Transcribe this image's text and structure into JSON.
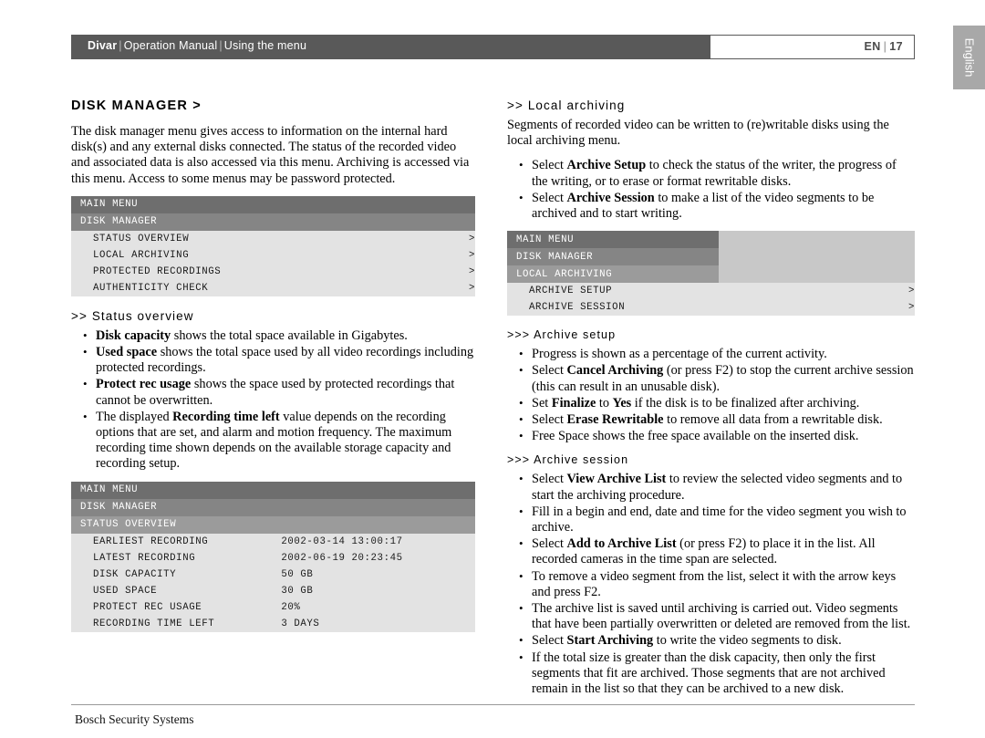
{
  "header": {
    "brand": "Divar",
    "manual": "Operation Manual",
    "chapter": "Using the menu",
    "lang": "EN",
    "page": "17",
    "side_tab": "English"
  },
  "left": {
    "title": "Disk manager >",
    "intro": "The disk manager menu gives access to information on the internal hard disk(s) and any external disks connected. The status of the recorded video and associated data is also accessed via this menu. Archiving is accessed via this menu. Access to some menus may be password protected.",
    "menu1": {
      "rows": [
        {
          "type": "main",
          "label": "MAIN MENU",
          "arrow": ""
        },
        {
          "type": "lvl2",
          "label": "DISK MANAGER",
          "arrow": ""
        },
        {
          "type": "item",
          "label": "STATUS OVERVIEW",
          "arrow": ">"
        },
        {
          "type": "item",
          "label": "LOCAL ARCHIVING",
          "arrow": ">"
        },
        {
          "type": "item",
          "label": "PROTECTED RECORDINGS",
          "arrow": ">"
        },
        {
          "type": "item",
          "label": "AUTHENTICITY CHECK",
          "arrow": ">"
        }
      ]
    },
    "status_overview": {
      "heading": ">> Status overview",
      "bullets": [
        {
          "bold": "Disk capacity",
          "rest": " shows the total space available in Gigabytes."
        },
        {
          "bold": "Used space",
          "rest": " shows the total space used by all video recordings including protected recordings."
        },
        {
          "bold": "Protect rec usage",
          "rest": " shows the space used by protected recordings that cannot be overwritten."
        },
        {
          "pre": "The displayed ",
          "bold": "Recording time left",
          "rest": " value depends on the recording options that are set, and alarm and motion frequency. The maximum recording time shown depends on the available storage capacity and recording setup."
        }
      ]
    },
    "menu2": {
      "rows": [
        {
          "type": "main",
          "label": "MAIN MENU",
          "value": ""
        },
        {
          "type": "lvl2",
          "label": "DISK MANAGER",
          "value": ""
        },
        {
          "type": "lvl3",
          "label": "STATUS OVERVIEW",
          "value": ""
        },
        {
          "type": "item",
          "label": "EARLIEST RECORDING",
          "value": "2002-03-14 13:00:17"
        },
        {
          "type": "item",
          "label": "LATEST RECORDING",
          "value": "2002-06-19 20:23:45"
        },
        {
          "type": "item",
          "label": "DISK CAPACITY",
          "value": "50 GB"
        },
        {
          "type": "item",
          "label": "USED SPACE",
          "value": "30 GB"
        },
        {
          "type": "item",
          "label": "PROTECT REC USAGE",
          "value": "20%"
        },
        {
          "type": "item",
          "label": "RECORDING TIME LEFT",
          "value": "3 DAYS"
        }
      ]
    }
  },
  "right": {
    "local_archiving": {
      "heading": ">> Local archiving",
      "intro": "Segments of recorded video can be written to (re)writable disks using the local archiving menu.",
      "bullets": [
        {
          "pre": "Select ",
          "bold": "Archive Setup",
          "rest": " to check the status of the writer, the progress of the writing, or to erase or format rewritable disks."
        },
        {
          "pre": "Select ",
          "bold": "Archive Session",
          "rest": " to make a list of the video segments to be archived and to start writing."
        }
      ]
    },
    "menu3": {
      "rows": [
        {
          "type": "main",
          "label": "MAIN MENU",
          "arrow": "",
          "split": true
        },
        {
          "type": "lvl2",
          "label": "DISK MANAGER",
          "arrow": "",
          "split": true
        },
        {
          "type": "lvl3",
          "label": "LOCAL ARCHIVING",
          "arrow": "",
          "split": true
        },
        {
          "type": "item",
          "label": "ARCHIVE SETUP",
          "arrow": ">",
          "split": false
        },
        {
          "type": "item",
          "label": "ARCHIVE SESSION",
          "arrow": ">",
          "split": false
        }
      ]
    },
    "archive_setup": {
      "heading": ">>> Archive setup",
      "bullets": [
        {
          "rest": "Progress is shown as a percentage of the current activity."
        },
        {
          "pre": "Select ",
          "bold": "Cancel Archiving",
          "rest": " (or press F2) to stop the current archive session (this can result in an unusable disk)."
        },
        {
          "pre": "Set ",
          "bold": "Finalize",
          "mid": " to ",
          "bold2": "Yes",
          "rest": " if the disk is to be finalized after archiving."
        },
        {
          "pre": "Select ",
          "bold": "Erase Rewritable",
          "rest": " to remove all data from a rewritable disk."
        },
        {
          "rest": "Free Space shows the free space available on the inserted disk."
        }
      ]
    },
    "archive_session": {
      "heading": ">>> Archive session",
      "bullets": [
        {
          "pre": "Select ",
          "bold": "View Archive List",
          "rest": " to review the selected video segments and to start the archiving procedure."
        },
        {
          "rest": "Fill in a begin and end, date and time for the video segment you wish to archive."
        },
        {
          "pre": "Select ",
          "bold": "Add to Archive List",
          "rest": " (or press F2) to place it in the list. All recorded cameras in the time span are selected."
        },
        {
          "rest": "To remove a video segment from the list, select it with the arrow keys and press F2."
        },
        {
          "rest": "The archive list is saved until archiving is carried out. Video segments that have been partially overwritten or deleted are removed from the list."
        },
        {
          "pre": "Select ",
          "bold": "Start Archiving",
          "rest": " to write the video segments to disk."
        },
        {
          "rest": "If the total size is greater than the disk capacity, then only the first segments that fit are archived. Those segments that are not archived remain in the list so that they can be archived to a new disk."
        }
      ]
    }
  },
  "footer": {
    "company": "Bosch Security Systems"
  }
}
